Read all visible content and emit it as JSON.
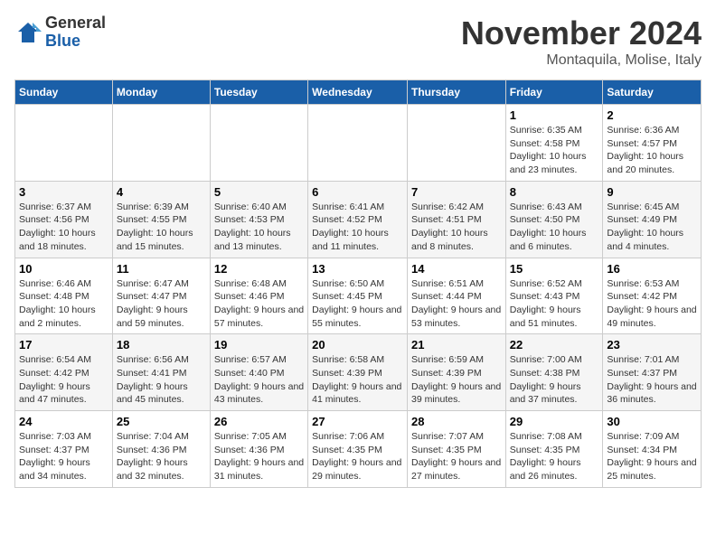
{
  "logo": {
    "general": "General",
    "blue": "Blue"
  },
  "title": "November 2024",
  "location": "Montaquila, Molise, Italy",
  "weekdays": [
    "Sunday",
    "Monday",
    "Tuesday",
    "Wednesday",
    "Thursday",
    "Friday",
    "Saturday"
  ],
  "weeks": [
    [
      {
        "day": "",
        "info": ""
      },
      {
        "day": "",
        "info": ""
      },
      {
        "day": "",
        "info": ""
      },
      {
        "day": "",
        "info": ""
      },
      {
        "day": "",
        "info": ""
      },
      {
        "day": "1",
        "info": "Sunrise: 6:35 AM\nSunset: 4:58 PM\nDaylight: 10 hours and 23 minutes."
      },
      {
        "day": "2",
        "info": "Sunrise: 6:36 AM\nSunset: 4:57 PM\nDaylight: 10 hours and 20 minutes."
      }
    ],
    [
      {
        "day": "3",
        "info": "Sunrise: 6:37 AM\nSunset: 4:56 PM\nDaylight: 10 hours and 18 minutes."
      },
      {
        "day": "4",
        "info": "Sunrise: 6:39 AM\nSunset: 4:55 PM\nDaylight: 10 hours and 15 minutes."
      },
      {
        "day": "5",
        "info": "Sunrise: 6:40 AM\nSunset: 4:53 PM\nDaylight: 10 hours and 13 minutes."
      },
      {
        "day": "6",
        "info": "Sunrise: 6:41 AM\nSunset: 4:52 PM\nDaylight: 10 hours and 11 minutes."
      },
      {
        "day": "7",
        "info": "Sunrise: 6:42 AM\nSunset: 4:51 PM\nDaylight: 10 hours and 8 minutes."
      },
      {
        "day": "8",
        "info": "Sunrise: 6:43 AM\nSunset: 4:50 PM\nDaylight: 10 hours and 6 minutes."
      },
      {
        "day": "9",
        "info": "Sunrise: 6:45 AM\nSunset: 4:49 PM\nDaylight: 10 hours and 4 minutes."
      }
    ],
    [
      {
        "day": "10",
        "info": "Sunrise: 6:46 AM\nSunset: 4:48 PM\nDaylight: 10 hours and 2 minutes."
      },
      {
        "day": "11",
        "info": "Sunrise: 6:47 AM\nSunset: 4:47 PM\nDaylight: 9 hours and 59 minutes."
      },
      {
        "day": "12",
        "info": "Sunrise: 6:48 AM\nSunset: 4:46 PM\nDaylight: 9 hours and 57 minutes."
      },
      {
        "day": "13",
        "info": "Sunrise: 6:50 AM\nSunset: 4:45 PM\nDaylight: 9 hours and 55 minutes."
      },
      {
        "day": "14",
        "info": "Sunrise: 6:51 AM\nSunset: 4:44 PM\nDaylight: 9 hours and 53 minutes."
      },
      {
        "day": "15",
        "info": "Sunrise: 6:52 AM\nSunset: 4:43 PM\nDaylight: 9 hours and 51 minutes."
      },
      {
        "day": "16",
        "info": "Sunrise: 6:53 AM\nSunset: 4:42 PM\nDaylight: 9 hours and 49 minutes."
      }
    ],
    [
      {
        "day": "17",
        "info": "Sunrise: 6:54 AM\nSunset: 4:42 PM\nDaylight: 9 hours and 47 minutes."
      },
      {
        "day": "18",
        "info": "Sunrise: 6:56 AM\nSunset: 4:41 PM\nDaylight: 9 hours and 45 minutes."
      },
      {
        "day": "19",
        "info": "Sunrise: 6:57 AM\nSunset: 4:40 PM\nDaylight: 9 hours and 43 minutes."
      },
      {
        "day": "20",
        "info": "Sunrise: 6:58 AM\nSunset: 4:39 PM\nDaylight: 9 hours and 41 minutes."
      },
      {
        "day": "21",
        "info": "Sunrise: 6:59 AM\nSunset: 4:39 PM\nDaylight: 9 hours and 39 minutes."
      },
      {
        "day": "22",
        "info": "Sunrise: 7:00 AM\nSunset: 4:38 PM\nDaylight: 9 hours and 37 minutes."
      },
      {
        "day": "23",
        "info": "Sunrise: 7:01 AM\nSunset: 4:37 PM\nDaylight: 9 hours and 36 minutes."
      }
    ],
    [
      {
        "day": "24",
        "info": "Sunrise: 7:03 AM\nSunset: 4:37 PM\nDaylight: 9 hours and 34 minutes."
      },
      {
        "day": "25",
        "info": "Sunrise: 7:04 AM\nSunset: 4:36 PM\nDaylight: 9 hours and 32 minutes."
      },
      {
        "day": "26",
        "info": "Sunrise: 7:05 AM\nSunset: 4:36 PM\nDaylight: 9 hours and 31 minutes."
      },
      {
        "day": "27",
        "info": "Sunrise: 7:06 AM\nSunset: 4:35 PM\nDaylight: 9 hours and 29 minutes."
      },
      {
        "day": "28",
        "info": "Sunrise: 7:07 AM\nSunset: 4:35 PM\nDaylight: 9 hours and 27 minutes."
      },
      {
        "day": "29",
        "info": "Sunrise: 7:08 AM\nSunset: 4:35 PM\nDaylight: 9 hours and 26 minutes."
      },
      {
        "day": "30",
        "info": "Sunrise: 7:09 AM\nSunset: 4:34 PM\nDaylight: 9 hours and 25 minutes."
      }
    ]
  ]
}
